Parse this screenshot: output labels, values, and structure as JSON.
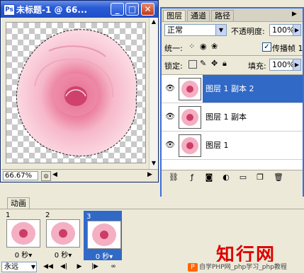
{
  "document": {
    "title": "未标题-1 @ 66...",
    "zoom": "66.67%"
  },
  "layers_panel": {
    "tabs": [
      "图层",
      "通道",
      "路径"
    ],
    "blend_mode": "正常",
    "opacity_label": "不透明度:",
    "opacity_value": "100%",
    "unify_label": "统一:",
    "propagate_label": "传播帧 1",
    "propagate_checked": true,
    "lock_label": "锁定:",
    "fill_label": "填充:",
    "fill_value": "100%",
    "layers": [
      {
        "name": "图层 1 副本 2",
        "selected": true
      },
      {
        "name": "图层 1 副本",
        "selected": false
      },
      {
        "name": "图层 1",
        "selected": false
      }
    ]
  },
  "animation_panel": {
    "tab": "动画",
    "frames": [
      {
        "number": "1",
        "delay": "0 秒▾",
        "selected": false
      },
      {
        "number": "2",
        "delay": "0 秒▾",
        "selected": false
      },
      {
        "number": "3",
        "delay": "0 秒▾",
        "selected": true
      }
    ],
    "loop": "永远"
  },
  "watermark": {
    "main": "知行网",
    "sub": "自学PHP网_php学习_php教程"
  },
  "colors": {
    "titlebar": "#2a5bd7",
    "selection": "#3169c6",
    "rose": "#f2a6bf",
    "watermark": "#dd0000"
  }
}
